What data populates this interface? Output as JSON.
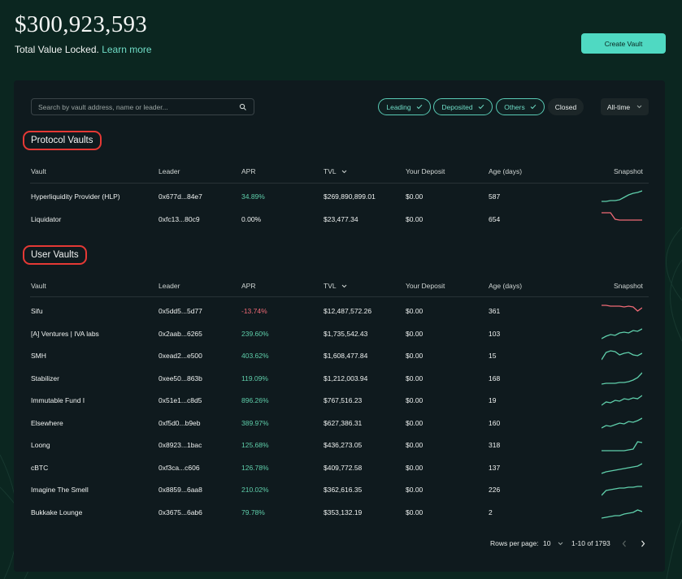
{
  "hero": {
    "tvl": "$300,923,593",
    "caption": "Total Value Locked.",
    "learn_more": "Learn more",
    "create_vault": "Create Vault"
  },
  "search": {
    "placeholder": "Search by vault address, name or leader..."
  },
  "filters": {
    "leading": "Leading",
    "deposited": "Deposited",
    "others": "Others",
    "closed": "Closed",
    "timeframe": "All-time"
  },
  "columns": {
    "vault": "Vault",
    "leader": "Leader",
    "apr": "APR",
    "tvl": "TVL",
    "deposit": "Your Deposit",
    "age": "Age (days)",
    "snapshot": "Snapshot"
  },
  "protocol": {
    "title": "Protocol Vaults",
    "rows": [
      {
        "name": "Hyperliquidity Provider (HLP)",
        "leader": "0x677d...84e7",
        "apr": "34.89%",
        "apr_trend": "pos",
        "tvl": "$269,890,899.01",
        "deposit": "$0.00",
        "age": "587",
        "spark_color": "#5fcfab",
        "spark": [
          3,
          3,
          4,
          4,
          5,
          8,
          11,
          13,
          14,
          16
        ]
      },
      {
        "name": "Liquidator",
        "leader": "0xfc13...80c9",
        "apr": "0.00%",
        "apr_trend": "zero",
        "tvl": "$23,477.34",
        "deposit": "$0.00",
        "age": "654",
        "spark_color": "#ef6a76",
        "spark": [
          17,
          17,
          17,
          9,
          8,
          8,
          8,
          8,
          8,
          8
        ]
      }
    ]
  },
  "user": {
    "title": "User Vaults",
    "rows": [
      {
        "name": "Sifu",
        "leader": "0x5dd5...5d77",
        "apr": "-13.74%",
        "apr_trend": "neg",
        "tvl": "$12,487,572.26",
        "deposit": "$0.00",
        "age": "361",
        "spark_color": "#ef6a76",
        "spark": [
          16,
          16,
          15,
          15,
          15,
          14,
          15,
          14,
          9,
          13
        ]
      },
      {
        "name": "[A] Ventures | IVA labs",
        "leader": "0x2aab...6265",
        "apr": "239.60%",
        "apr_trend": "pos",
        "tvl": "$1,735,542.43",
        "deposit": "$0.00",
        "age": "103",
        "spark_color": "#5fcfab",
        "spark": [
          3,
          6,
          8,
          7,
          10,
          11,
          10,
          13,
          12,
          15
        ]
      },
      {
        "name": "SMH",
        "leader": "0xead2...e500",
        "apr": "403.62%",
        "apr_trend": "pos",
        "tvl": "$1,608,477.84",
        "deposit": "$0.00",
        "age": "15",
        "spark_color": "#5fcfab",
        "spark": [
          4,
          13,
          15,
          14,
          10,
          12,
          13,
          10,
          9,
          12
        ]
      },
      {
        "name": "Stabilizer",
        "leader": "0xee50...863b",
        "apr": "119.09%",
        "apr_trend": "pos",
        "tvl": "$1,212,003.94",
        "deposit": "$0.00",
        "age": "168",
        "spark_color": "#5fcfab",
        "spark": [
          2,
          3,
          3,
          3,
          4,
          4,
          5,
          7,
          10,
          16
        ]
      },
      {
        "name": "Immutable Fund I",
        "leader": "0x51e1...c8d5",
        "apr": "896.26%",
        "apr_trend": "pos",
        "tvl": "$767,516.23",
        "deposit": "$0.00",
        "age": "19",
        "spark_color": "#5fcfab",
        "spark": [
          3,
          7,
          6,
          9,
          8,
          11,
          10,
          12,
          11,
          15
        ]
      },
      {
        "name": "Elsewhere",
        "leader": "0xf5d0...b9eb",
        "apr": "389.97%",
        "apr_trend": "pos",
        "tvl": "$627,386.31",
        "deposit": "$0.00",
        "age": "160",
        "spark_color": "#5fcfab",
        "spark": [
          3,
          6,
          5,
          7,
          9,
          8,
          11,
          10,
          12,
          15
        ]
      },
      {
        "name": "Loong",
        "leader": "0x8923...1bac",
        "apr": "125.68%",
        "apr_trend": "pos",
        "tvl": "$436,273.05",
        "deposit": "$0.00",
        "age": "318",
        "spark_color": "#5fcfab",
        "spark": [
          2,
          2,
          2,
          2,
          2,
          2,
          3,
          4,
          13,
          12
        ]
      },
      {
        "name": "cBTC",
        "leader": "0xf3ca...c606",
        "apr": "126.78%",
        "apr_trend": "pos",
        "tvl": "$409,772.58",
        "deposit": "$0.00",
        "age": "137",
        "spark_color": "#5fcfab",
        "spark": [
          2,
          4,
          5,
          6,
          7,
          8,
          9,
          10,
          11,
          14
        ]
      },
      {
        "name": "Imagine The Smell",
        "leader": "0x8859...6aa8",
        "apr": "210.02%",
        "apr_trend": "pos",
        "tvl": "$362,616.35",
        "deposit": "$0.00",
        "age": "226",
        "spark_color": "#5fcfab",
        "spark": [
          2,
          8,
          9,
          10,
          11,
          11,
          12,
          12,
          13,
          13
        ]
      },
      {
        "name": "Bukkake Lounge",
        "leader": "0x3675...6ab6",
        "apr": "79.78%",
        "apr_trend": "pos",
        "tvl": "$353,132.19",
        "deposit": "$0.00",
        "age": "2",
        "spark_color": "#5fcfab",
        "spark": [
          2,
          3,
          4,
          5,
          5,
          7,
          8,
          9,
          12,
          10
        ]
      }
    ]
  },
  "pagination": {
    "rows_per_page_label": "Rows per page:",
    "rows_per_page": "10",
    "range": "1-10 of 1793"
  }
}
